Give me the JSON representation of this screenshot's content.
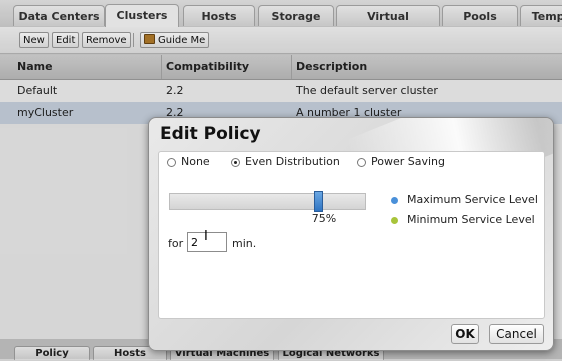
{
  "top_tabs": [
    {
      "label": "Data Centers",
      "active": false
    },
    {
      "label": "Clusters",
      "active": true
    },
    {
      "label": "Hosts",
      "active": false
    },
    {
      "label": "Storage",
      "active": false
    },
    {
      "label": "Virtual Machines",
      "active": false
    },
    {
      "label": "Pools",
      "active": false
    },
    {
      "label": "Templ",
      "active": false
    }
  ],
  "toolbar": {
    "new_label": "New",
    "edit_label": "Edit",
    "remove_label": "Remove",
    "guide_label": "Guide Me",
    "guide_icon": "guide-book-icon"
  },
  "table": {
    "columns": [
      "Name",
      "Compatibility Version",
      "Description"
    ],
    "rows": [
      {
        "name": "Default",
        "version": "2.2",
        "description": "The default server cluster",
        "selected": false
      },
      {
        "name": "myCluster",
        "version": "2.2",
        "description": "A number 1 cluster",
        "selected": true
      }
    ]
  },
  "bottom_tabs": [
    "Policy",
    "Hosts",
    "Virtual Machines",
    "Logical Networks"
  ],
  "dialog": {
    "title": "Edit Policy",
    "options": [
      {
        "label": "None",
        "selected": false
      },
      {
        "label": "Even Distribution",
        "selected": true
      },
      {
        "label": "Power Saving",
        "selected": false
      }
    ],
    "slider": {
      "value_percent": 75,
      "label": "75%"
    },
    "legend": [
      {
        "label": "Maximum Service Level",
        "color": "#4a90d9"
      },
      {
        "label": "Minimum Service Level",
        "color": "#a8c43a"
      }
    ],
    "for_label": "for",
    "minutes_value": "2",
    "minutes_unit": "min.",
    "ok_label": "OK",
    "cancel_label": "Cancel"
  },
  "colors": {
    "selected_row": "#c7d1de",
    "slider_thumb": "#2f74c2"
  }
}
